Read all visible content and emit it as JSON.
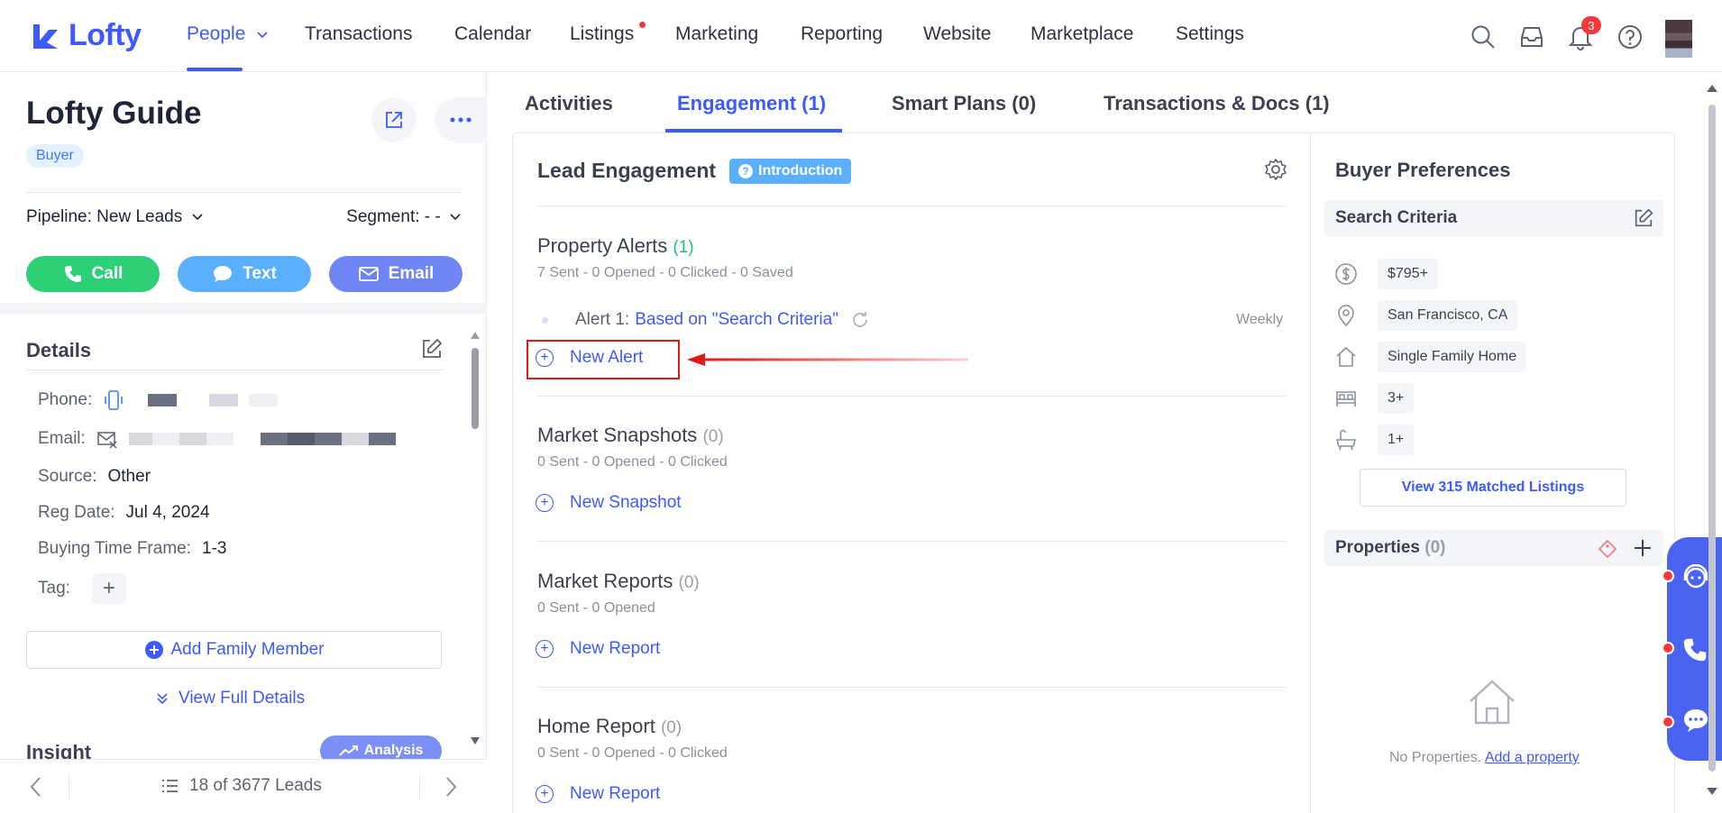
{
  "brand": {
    "name": "Lofty",
    "color": "#3d5afe"
  },
  "nav": {
    "items": [
      "People",
      "Transactions",
      "Calendar",
      "Listings",
      "Marketing",
      "Reporting",
      "Website",
      "Marketplace",
      "Settings"
    ],
    "notifications_count": "3"
  },
  "lead": {
    "name": "Lofty Guide",
    "tag": "Buyer",
    "pipeline_label": "Pipeline:",
    "pipeline_value": "New Leads",
    "segment_label": "Segment:",
    "segment_value": "- -",
    "actions": {
      "call": "Call",
      "text": "Text",
      "email": "Email"
    }
  },
  "details": {
    "title": "Details",
    "phone_label": "Phone:",
    "email_label": "Email:",
    "source_label": "Source:",
    "source_value": "Other",
    "reg_label": "Reg Date:",
    "reg_value": "Jul 4, 2024",
    "timeframe_label": "Buying Time Frame:",
    "timeframe_value": "1-3",
    "tag_label": "Tag:",
    "add_family": "Add Family Member",
    "view_full": "View Full Details"
  },
  "insight": {
    "title": "Insight",
    "analysis_label": "Analysis"
  },
  "footer": {
    "leads_count": "18 of 3677 Leads"
  },
  "tabs": [
    "Activities",
    "Engagement (1)",
    "Smart Plans (0)",
    "Transactions & Docs (1)"
  ],
  "engagement": {
    "title": "Lead Engagement",
    "intro_label": "Introduction",
    "property_alerts": {
      "title": "Property Alerts",
      "count": "(1)",
      "stats": "7 Sent - 0 Opened - 0 Clicked - 0 Saved",
      "alert_prefix": "Alert 1:",
      "alert_link": "Based on \"Search Criteria\"",
      "frequency": "Weekly",
      "new_label": "New Alert"
    },
    "market_snapshots": {
      "title": "Market Snapshots",
      "count": "(0)",
      "stats": "0 Sent - 0 Opened - 0 Clicked",
      "new_label": "New Snapshot"
    },
    "market_reports": {
      "title": "Market Reports",
      "count": "(0)",
      "stats": "0 Sent - 0 Opened",
      "new_label": "New Report"
    },
    "home_report": {
      "title": "Home Report",
      "count": "(0)",
      "stats": "0 Sent - 0 Opened - 0 Clicked",
      "new_label": "New Report"
    }
  },
  "buyer_prefs": {
    "title": "Buyer Preferences",
    "search_criteria_label": "Search Criteria",
    "price": "$795+",
    "location": "San Francisco, CA",
    "property_type": "Single Family Home",
    "bedrooms": "3+",
    "bathrooms": "1+",
    "matched_listings": "View 315 Matched Listings",
    "properties_label": "Properties",
    "properties_count": "(0)",
    "no_props": "No Properties.",
    "add_property": "Add a property"
  }
}
